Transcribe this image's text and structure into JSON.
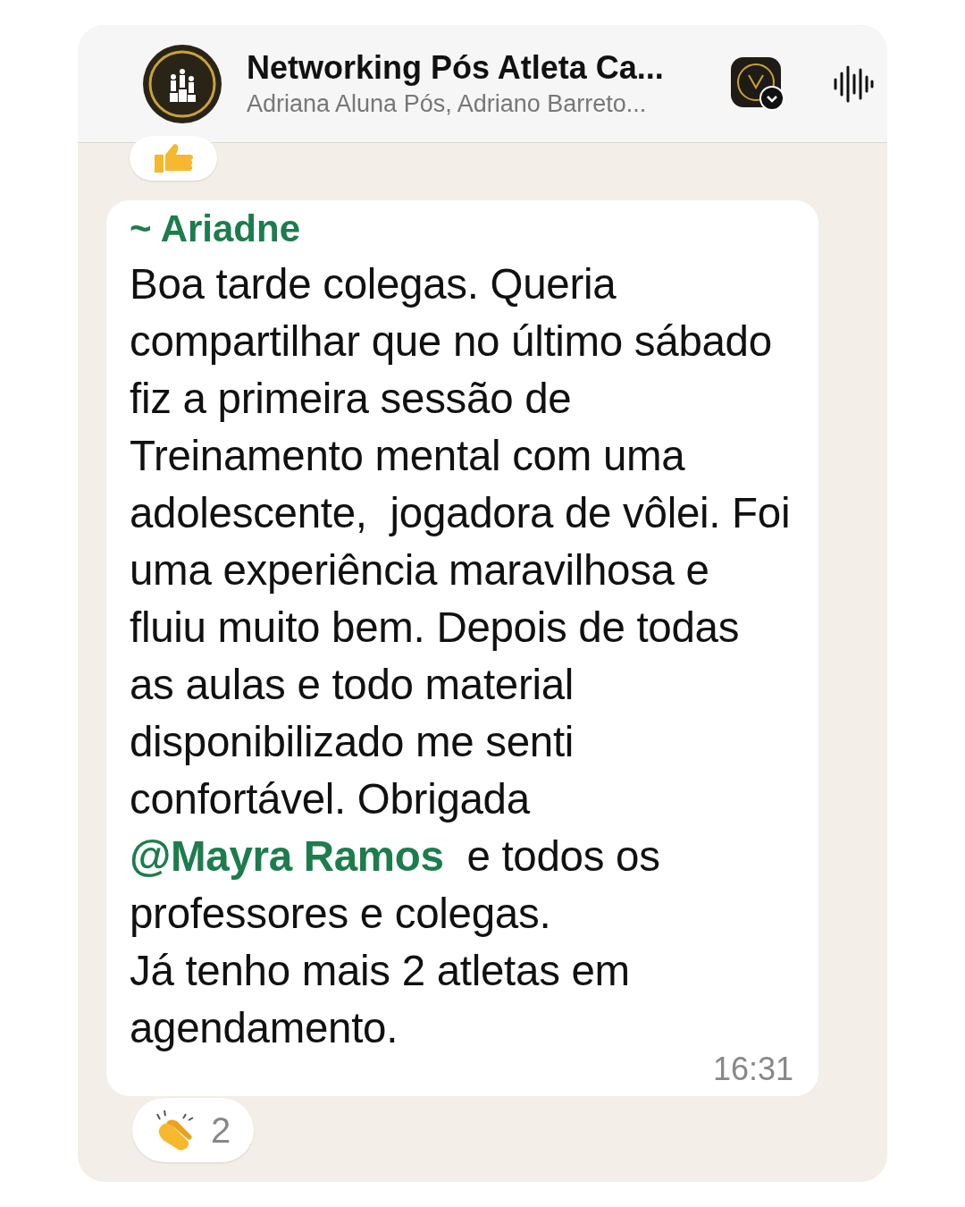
{
  "header": {
    "title": "Networking Pós Atleta Ca...",
    "subtitle": "Adriana Aluna Pós, Adriano Barreto..."
  },
  "top_reaction": {
    "kind": "thumbs_up"
  },
  "message": {
    "sender": "~ Ariadne",
    "text_before": "Boa tarde colegas. Queria compartilhar que no último sábado fiz a primeira sessão de Treinamento mental com uma adolescente,  jogadora de vôlei. Foi uma experiência maravilhosa e fluiu muito bem. Depois de todas as aulas e todo material disponibilizado me senti confortável. Obrigada ",
    "mention": "@Mayra Ramos",
    "text_after": "  e todos os professores e colegas.\nJá tenho mais 2 atletas em agendamento.",
    "time": "16:31"
  },
  "reaction": {
    "kind": "clap",
    "count": "2"
  }
}
